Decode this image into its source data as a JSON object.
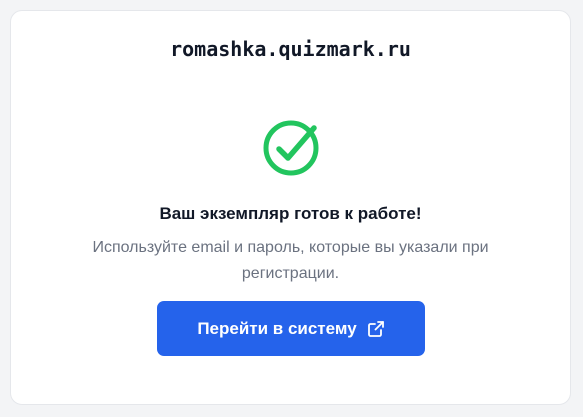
{
  "card": {
    "domain": "romashka.quizmark.ru",
    "headline": "Ваш экземпляр готов к работе!",
    "description": "Используйте email и пароль, которые вы указали при регистрации.",
    "button_label": "Перейти в систему"
  },
  "icons": {
    "status": "check-circle-icon",
    "button": "external-link-icon"
  },
  "colors": {
    "success": "#22c55e",
    "primary": "#2563eb",
    "text": "#111827",
    "muted": "#6b7280"
  }
}
